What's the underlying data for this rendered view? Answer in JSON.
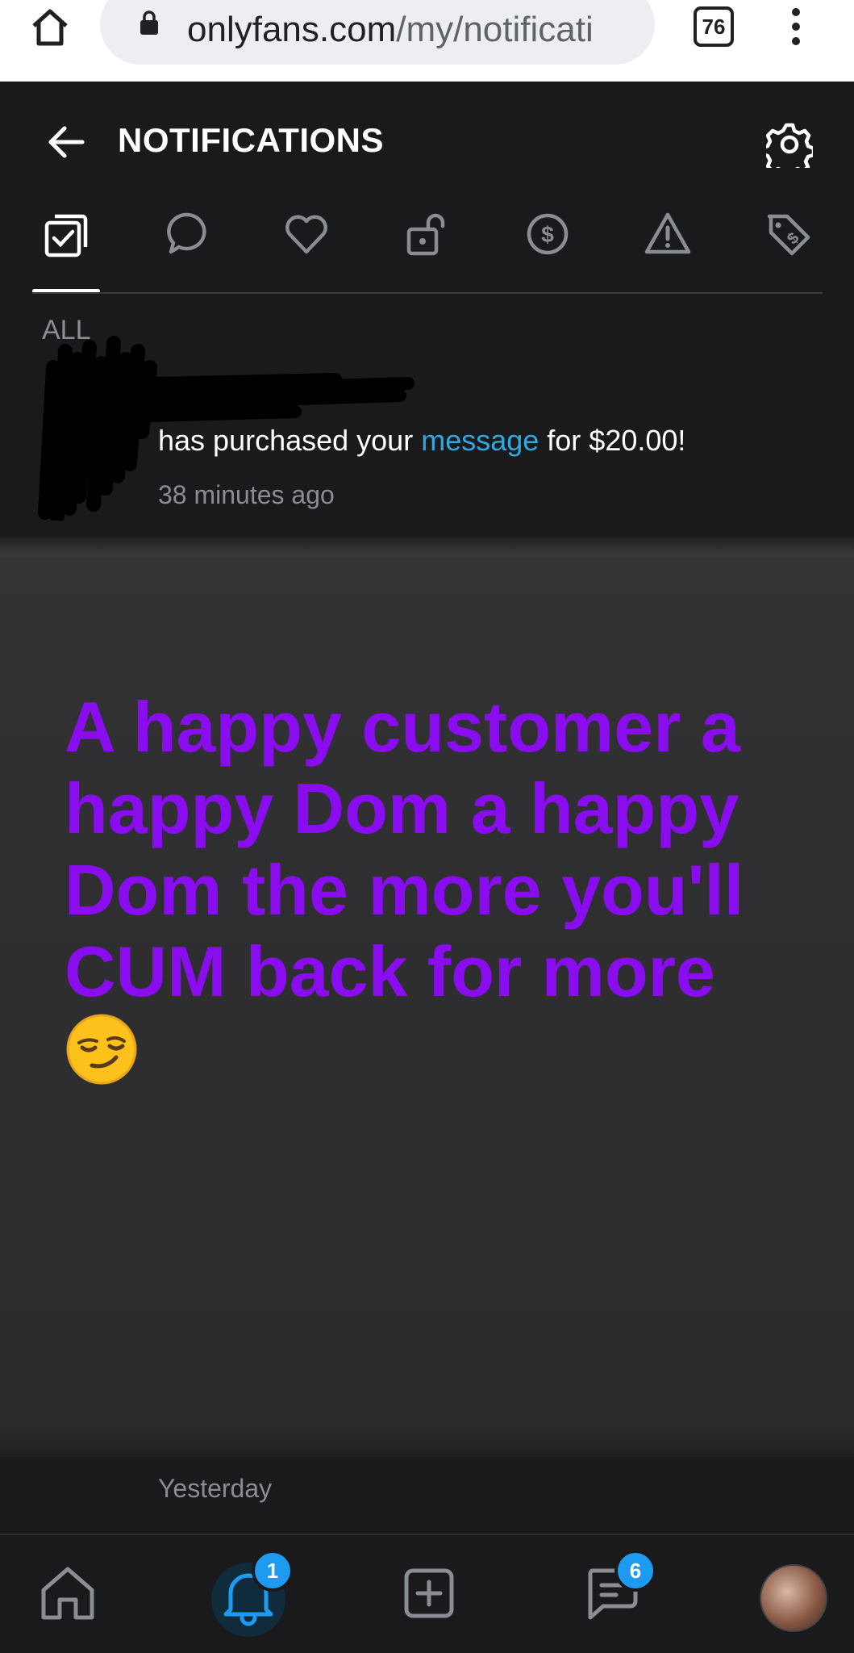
{
  "browser": {
    "url_host": "onlyfans.com",
    "url_path": "/my/notificati",
    "tab_count": "76"
  },
  "header": {
    "title": "NOTIFICATIONS"
  },
  "filters": [
    {
      "icon": "all-icon",
      "active": true
    },
    {
      "icon": "comment-icon"
    },
    {
      "icon": "heart-icon"
    },
    {
      "icon": "unlock-icon"
    },
    {
      "icon": "dollar-icon"
    },
    {
      "icon": "warning-icon"
    },
    {
      "icon": "tag-icon"
    }
  ],
  "section_label": "ALL",
  "notification": {
    "text_before": "has purchased your ",
    "link": "message",
    "text_after": " for $20.00!",
    "time": "38 minutes ago"
  },
  "caption": {
    "text": "A happy customer a happy Dom a happy Dom the more you'll CUM back for more",
    "emoji": "smirking-face-emoji"
  },
  "yesterday_label": "Yesterday",
  "bottom_nav": {
    "notifications_badge": "1",
    "messages_badge": "6"
  },
  "colors": {
    "accent": "#1d9bf0",
    "link": "#2fa9e1",
    "caption": "#8a0df0",
    "background": "#1a1a1d"
  }
}
